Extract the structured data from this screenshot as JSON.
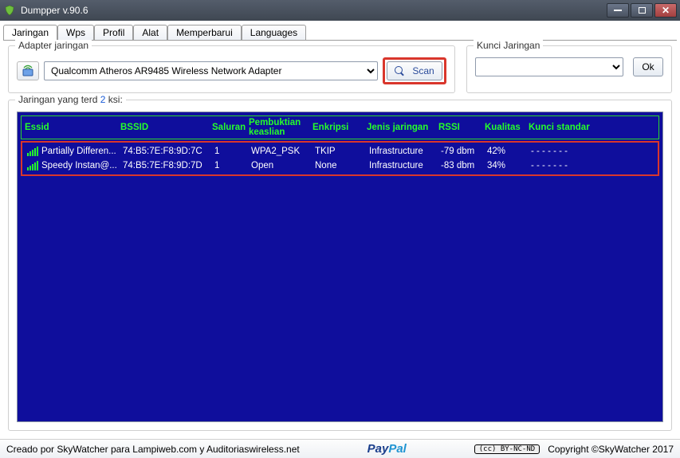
{
  "window": {
    "title": "Dumpper v.90.6"
  },
  "tabs": [
    "Jaringan",
    "Wps",
    "Profil",
    "Alat",
    "Memperbarui",
    "Languages"
  ],
  "adapter": {
    "legend": "Adapter jaringan",
    "selected": "Qualcomm Atheros AR9485 Wireless Network Adapter",
    "scan_label": "Scan"
  },
  "key": {
    "legend": "Kunci Jaringan",
    "value": "",
    "ok_label": "Ok"
  },
  "detected": {
    "legend_prefix": "Jaringan yang terd",
    "count": "2",
    "legend_suffix": "ksi:",
    "headers": {
      "essid": "Essid",
      "bssid": "BSSID",
      "ch": "Saluran",
      "auth": "Pembuktian keaslian",
      "enc": "Enkripsi",
      "net": "Jenis jaringan",
      "rssi": "RSSI",
      "qual": "Kualitas",
      "key": "Kunci standar"
    },
    "rows": [
      {
        "essid": "Partially Differen...",
        "bssid": "74:B5:7E:F8:9D:7C",
        "ch": "1",
        "auth": "WPA2_PSK",
        "enc": "TKIP",
        "net": "Infrastructure",
        "rssi": "-79 dbm",
        "qual": "42%",
        "key": "- - - - - - -"
      },
      {
        "essid": "Speedy Instan@...",
        "bssid": "74:B5:7E:F8:9D:7D",
        "ch": "1",
        "auth": "Open",
        "enc": "None",
        "net": "Infrastructure",
        "rssi": "-83 dbm",
        "qual": "34%",
        "key": "- - - - - - -"
      }
    ]
  },
  "footer": {
    "left": "Creado por SkyWatcher para Lampiweb.com y Auditoriaswireless.net",
    "cc": "(cc) BY-NC-ND",
    "right": "Copyright ©SkyWatcher 2017"
  }
}
